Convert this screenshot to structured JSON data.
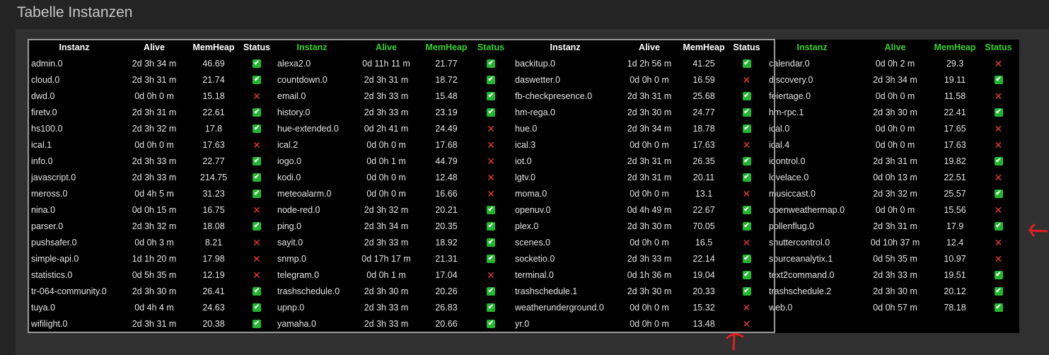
{
  "title": "Tabelle Instanzen",
  "colors": {
    "ok": "#1fb82f",
    "fail": "#f03a3a",
    "header_green": "#36d12f",
    "annotation": "#e02020"
  },
  "headers": {
    "instanz": "Instanz",
    "alive": "Alive",
    "memheap": "MemHeap",
    "status": "Status"
  },
  "blocks": [
    {
      "header_color": "white",
      "rows": [
        {
          "name": "admin.0",
          "alive": "2d 3h 34 m",
          "mem": "46.69",
          "ok": true
        },
        {
          "name": "cloud.0",
          "alive": "2d 3h 31 m",
          "mem": "21.74",
          "ok": true
        },
        {
          "name": "dwd.0",
          "alive": "0d 0h 0 m",
          "mem": "15.18",
          "ok": false
        },
        {
          "name": "firetv.0",
          "alive": "2d 3h 31 m",
          "mem": "22.61",
          "ok": true
        },
        {
          "name": "hs100.0",
          "alive": "2d 3h 32 m",
          "mem": "17.8",
          "ok": true
        },
        {
          "name": "ical.1",
          "alive": "0d 0h 0 m",
          "mem": "17.63",
          "ok": false
        },
        {
          "name": "info.0",
          "alive": "2d 3h 33 m",
          "mem": "22.77",
          "ok": true
        },
        {
          "name": "javascript.0",
          "alive": "2d 3h 33 m",
          "mem": "214.75",
          "ok": true
        },
        {
          "name": "meross.0",
          "alive": "0d 4h 5 m",
          "mem": "31.23",
          "ok": true
        },
        {
          "name": "nina.0",
          "alive": "0d 0h 15 m",
          "mem": "16.75",
          "ok": false
        },
        {
          "name": "parser.0",
          "alive": "2d 3h 32 m",
          "mem": "18.08",
          "ok": true
        },
        {
          "name": "pushsafer.0",
          "alive": "0d 0h 3 m",
          "mem": "8.21",
          "ok": false
        },
        {
          "name": "simple-api.0",
          "alive": "1d 1h 20 m",
          "mem": "17.98",
          "ok": false
        },
        {
          "name": "statistics.0",
          "alive": "0d 5h 35 m",
          "mem": "12.19",
          "ok": false
        },
        {
          "name": "tr-064-community.0",
          "alive": "2d 3h 30 m",
          "mem": "26.41",
          "ok": true
        },
        {
          "name": "tuya.0",
          "alive": "0d 4h 4 m",
          "mem": "24.63",
          "ok": true
        },
        {
          "name": "wifilight.0",
          "alive": "2d 3h 31 m",
          "mem": "20.38",
          "ok": true
        }
      ]
    },
    {
      "header_color": "green",
      "rows": [
        {
          "name": "alexa2.0",
          "alive": "0d 11h 11 m",
          "mem": "21.77",
          "ok": true
        },
        {
          "name": "countdown.0",
          "alive": "2d 3h 31 m",
          "mem": "18.72",
          "ok": true
        },
        {
          "name": "email.0",
          "alive": "2d 3h 33 m",
          "mem": "15.48",
          "ok": true
        },
        {
          "name": "history.0",
          "alive": "2d 3h 33 m",
          "mem": "23.19",
          "ok": true
        },
        {
          "name": "hue-extended.0",
          "alive": "0d 2h 41 m",
          "mem": "24.49",
          "ok": false
        },
        {
          "name": "ical.2",
          "alive": "0d 0h 0 m",
          "mem": "17.68",
          "ok": false
        },
        {
          "name": "iogo.0",
          "alive": "0d 0h 1 m",
          "mem": "44.79",
          "ok": false
        },
        {
          "name": "kodi.0",
          "alive": "0d 0h 0 m",
          "mem": "12.48",
          "ok": false
        },
        {
          "name": "meteoalarm.0",
          "alive": "0d 0h 0 m",
          "mem": "16.66",
          "ok": false
        },
        {
          "name": "node-red.0",
          "alive": "2d 3h 32 m",
          "mem": "20.21",
          "ok": true
        },
        {
          "name": "ping.0",
          "alive": "2d 3h 34 m",
          "mem": "20.35",
          "ok": true
        },
        {
          "name": "sayit.0",
          "alive": "2d 3h 33 m",
          "mem": "18.92",
          "ok": true
        },
        {
          "name": "snmp.0",
          "alive": "0d 17h 17 m",
          "mem": "21.31",
          "ok": true
        },
        {
          "name": "telegram.0",
          "alive": "0d 0h 1 m",
          "mem": "17.04",
          "ok": false
        },
        {
          "name": "trashschedule.0",
          "alive": "2d 3h 30 m",
          "mem": "20.26",
          "ok": true
        },
        {
          "name": "upnp.0",
          "alive": "2d 3h 33 m",
          "mem": "26.83",
          "ok": true
        },
        {
          "name": "yamaha.0",
          "alive": "2d 3h 33 m",
          "mem": "20.66",
          "ok": true
        }
      ]
    },
    {
      "header_color": "white",
      "rows": [
        {
          "name": "backitup.0",
          "alive": "1d 2h 56 m",
          "mem": "41.25",
          "ok": true
        },
        {
          "name": "daswetter.0",
          "alive": "0d 0h 0 m",
          "mem": "16.59",
          "ok": false
        },
        {
          "name": "fb-checkpresence.0",
          "alive": "2d 3h 31 m",
          "mem": "25.68",
          "ok": true
        },
        {
          "name": "hm-rega.0",
          "alive": "2d 3h 30 m",
          "mem": "24.77",
          "ok": true
        },
        {
          "name": "hue.0",
          "alive": "2d 3h 34 m",
          "mem": "18.78",
          "ok": true
        },
        {
          "name": "ical.3",
          "alive": "0d 0h 0 m",
          "mem": "17.63",
          "ok": false
        },
        {
          "name": "iot.0",
          "alive": "2d 3h 31 m",
          "mem": "26.35",
          "ok": true
        },
        {
          "name": "lgtv.0",
          "alive": "2d 3h 31 m",
          "mem": "20.11",
          "ok": true
        },
        {
          "name": "moma.0",
          "alive": "0d 0h 0 m",
          "mem": "13.1",
          "ok": false
        },
        {
          "name": "openuv.0",
          "alive": "0d 4h 49 m",
          "mem": "22.67",
          "ok": true
        },
        {
          "name": "plex.0",
          "alive": "2d 3h 30 m",
          "mem": "70.05",
          "ok": true
        },
        {
          "name": "scenes.0",
          "alive": "0d 0h 0 m",
          "mem": "16.5",
          "ok": false
        },
        {
          "name": "socketio.0",
          "alive": "2d 3h 33 m",
          "mem": "22.14",
          "ok": true
        },
        {
          "name": "terminal.0",
          "alive": "0d 1h 36 m",
          "mem": "19.04",
          "ok": true
        },
        {
          "name": "trashschedule.1",
          "alive": "2d 3h 30 m",
          "mem": "20.33",
          "ok": true
        },
        {
          "name": "weatherunderground.0",
          "alive": "0d 0h 0 m",
          "mem": "15.32",
          "ok": false
        },
        {
          "name": "yr.0",
          "alive": "0d 0h 0 m",
          "mem": "13.48",
          "ok": false
        }
      ]
    },
    {
      "header_color": "green",
      "rows": [
        {
          "name": "calendar.0",
          "alive": "0d 0h 2 m",
          "mem": "29.3",
          "ok": false
        },
        {
          "name": "discovery.0",
          "alive": "2d 3h 34 m",
          "mem": "19.11",
          "ok": true
        },
        {
          "name": "feiertage.0",
          "alive": "0d 0h 0 m",
          "mem": "11.58",
          "ok": false
        },
        {
          "name": "hm-rpc.1",
          "alive": "2d 3h 30 m",
          "mem": "22.41",
          "ok": true
        },
        {
          "name": "ical.0",
          "alive": "0d 0h 0 m",
          "mem": "17.65",
          "ok": false
        },
        {
          "name": "ical.4",
          "alive": "0d 0h 0 m",
          "mem": "17.63",
          "ok": false
        },
        {
          "name": "iqontrol.0",
          "alive": "2d 3h 31 m",
          "mem": "19.82",
          "ok": true
        },
        {
          "name": "lovelace.0",
          "alive": "0d 0h 13 m",
          "mem": "22.51",
          "ok": false
        },
        {
          "name": "musiccast.0",
          "alive": "2d 3h 32 m",
          "mem": "25.57",
          "ok": true
        },
        {
          "name": "openweathermap.0",
          "alive": "0d 0h 0 m",
          "mem": "15.56",
          "ok": false
        },
        {
          "name": "pollenflug.0",
          "alive": "2d 3h 31 m",
          "mem": "17.9",
          "ok": true
        },
        {
          "name": "shuttercontrol.0",
          "alive": "0d 10h 37 m",
          "mem": "12.4",
          "ok": false
        },
        {
          "name": "sourceanalytix.1",
          "alive": "0d 5h 35 m",
          "mem": "10.97",
          "ok": false
        },
        {
          "name": "text2command.0",
          "alive": "2d 3h 33 m",
          "mem": "19.51",
          "ok": true
        },
        {
          "name": "trashschedule.2",
          "alive": "2d 3h 30 m",
          "mem": "20.12",
          "ok": true
        },
        {
          "name": "web.0",
          "alive": "0d 0h 57 m",
          "mem": "78.18",
          "ok": true
        }
      ]
    }
  ]
}
